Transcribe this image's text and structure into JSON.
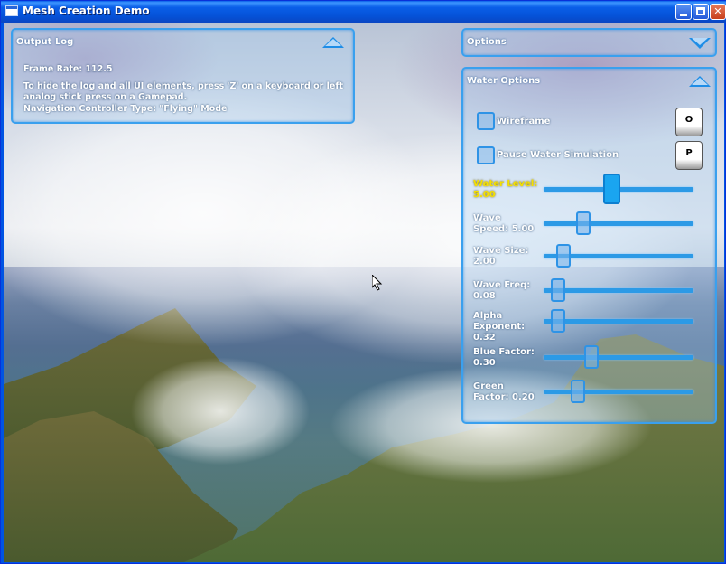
{
  "window": {
    "title": "Mesh Creation Demo",
    "minimize_icon": "minimize-icon",
    "maximize_icon": "maximize-icon",
    "close_icon": "close-icon"
  },
  "output_log": {
    "title": "Output Log",
    "collapse_icon": "triangle-up-icon",
    "lines": [
      "Frame Rate: 112.5",
      "To hide the log and all UI elements, press 'Z' on a keyboard or left",
      "analog stick press on a Gamepad.",
      "Navigation Controller Type: \"Flying\" Mode"
    ]
  },
  "options": {
    "title": "Options",
    "expand_icon": "triangle-down-icon"
  },
  "water_options": {
    "title": "Water Options",
    "collapse_icon": "triangle-up-icon",
    "checkboxes": [
      {
        "label": "Wireframe",
        "checked": false,
        "key": "O"
      },
      {
        "label": "Pause Water Simulation",
        "checked": false,
        "key": "P"
      }
    ],
    "sliders": [
      {
        "label": "Water Level:\n 5.00",
        "value": 0.45,
        "active": true
      },
      {
        "label": "Wave\nSpeed: 5.00",
        "value": 0.24
      },
      {
        "label": "Wave Size:\n2.00",
        "value": 0.09
      },
      {
        "label": "Wave Freq:\n0.08",
        "value": 0.05
      },
      {
        "label": "Alpha\nExponent:\n0.32",
        "value": 0.05
      },
      {
        "label": "Blue Factor:\n0.30",
        "value": 0.3
      },
      {
        "label": "Green\nFactor: 0.20",
        "value": 0.2
      }
    ]
  },
  "colors": {
    "panel_border": "#3aa0ee",
    "active_label": "#f5e000",
    "titlebar": "#0a5fe8"
  }
}
